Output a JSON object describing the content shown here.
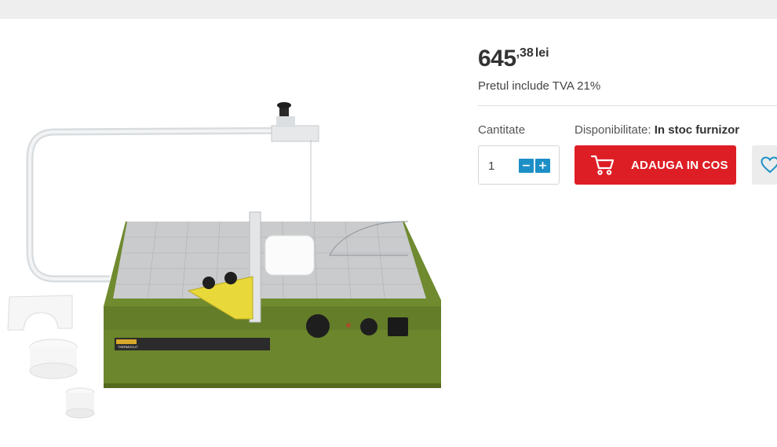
{
  "product": {
    "image_alt": "Proxxon Thermocut hot wire foam cutter",
    "brand_plate": "PROXXON",
    "model_plate": "THERMOCUT"
  },
  "price": {
    "integer": "645",
    "decimals": ",38",
    "currency": "lei",
    "vat_note": "Pretul include TVA 21%"
  },
  "purchase": {
    "quantity_label": "Cantitate",
    "quantity_value": "1",
    "minus_icon": "minus-icon",
    "plus_icon": "plus-icon",
    "availability_label": "Disponibilitate:",
    "availability_value": "In stoc furnizor",
    "add_to_cart_label": "ADAUGA IN COS",
    "cart_icon": "cart-icon",
    "wishlist_icon": "heart-icon"
  },
  "colors": {
    "add_to_cart_bg": "#de1e25",
    "qty_button_bg": "#1d8fc7",
    "machine_body": "#6f8a2f"
  }
}
